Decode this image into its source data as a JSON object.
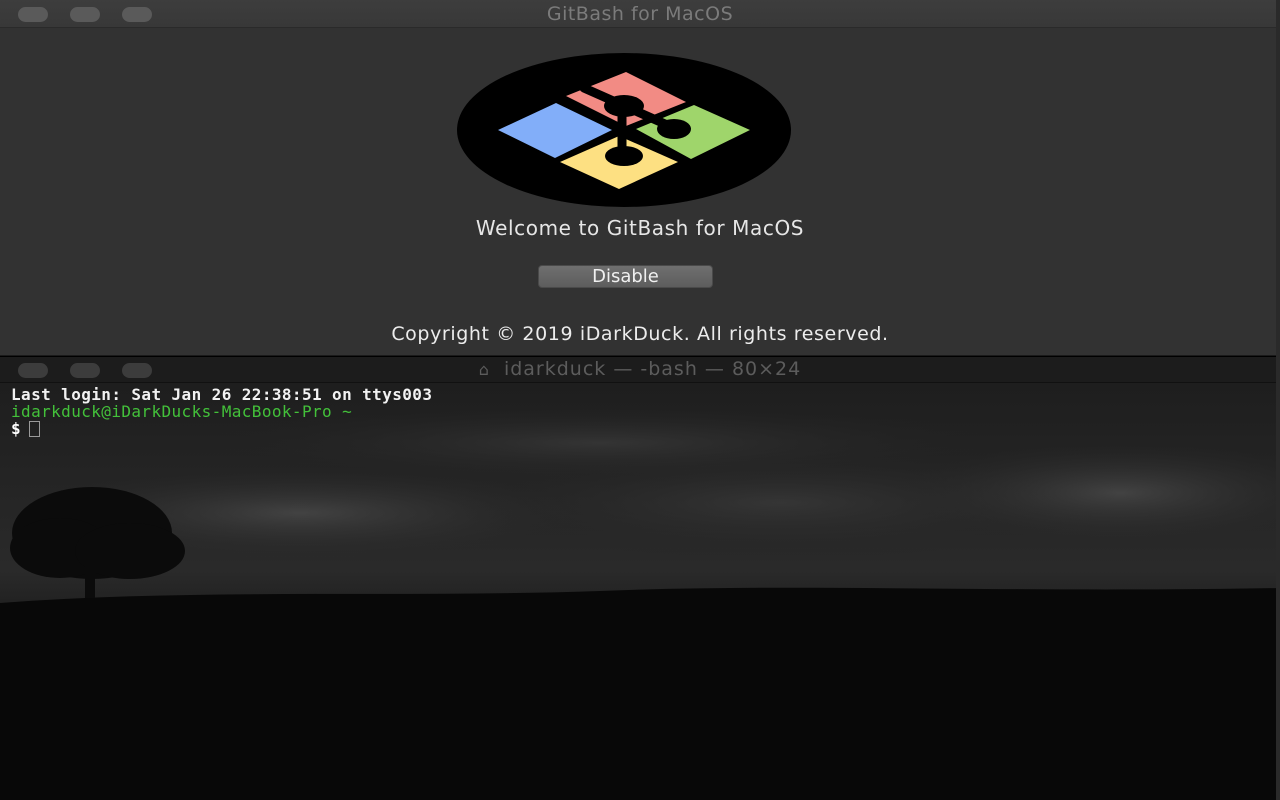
{
  "app_window": {
    "title": "GitBash for MacOS",
    "welcome_text": "Welcome to GitBash for MacOS",
    "disable_label": "Disable",
    "copyright": "Copyright © 2019 iDarkDuck. All rights reserved.",
    "logo_icon": "git-windows-logo-icon",
    "logo_colors": {
      "red": "#f28b84",
      "green": "#9fd56b",
      "blue": "#82aef9",
      "yellow": "#fde082",
      "background": "#000000"
    }
  },
  "terminal_window": {
    "title": "idarkduck — -bash — 80×24",
    "title_icon": "home-folder-icon",
    "lines": {
      "last_login": "Last login: Sat Jan 26 22:38:51 on ttys003",
      "prompt_user": "idarkduck@iDarkDucks-MacBook-Pro ~",
      "prompt_symbol": "$"
    },
    "prompt_color": "#43c13a"
  }
}
